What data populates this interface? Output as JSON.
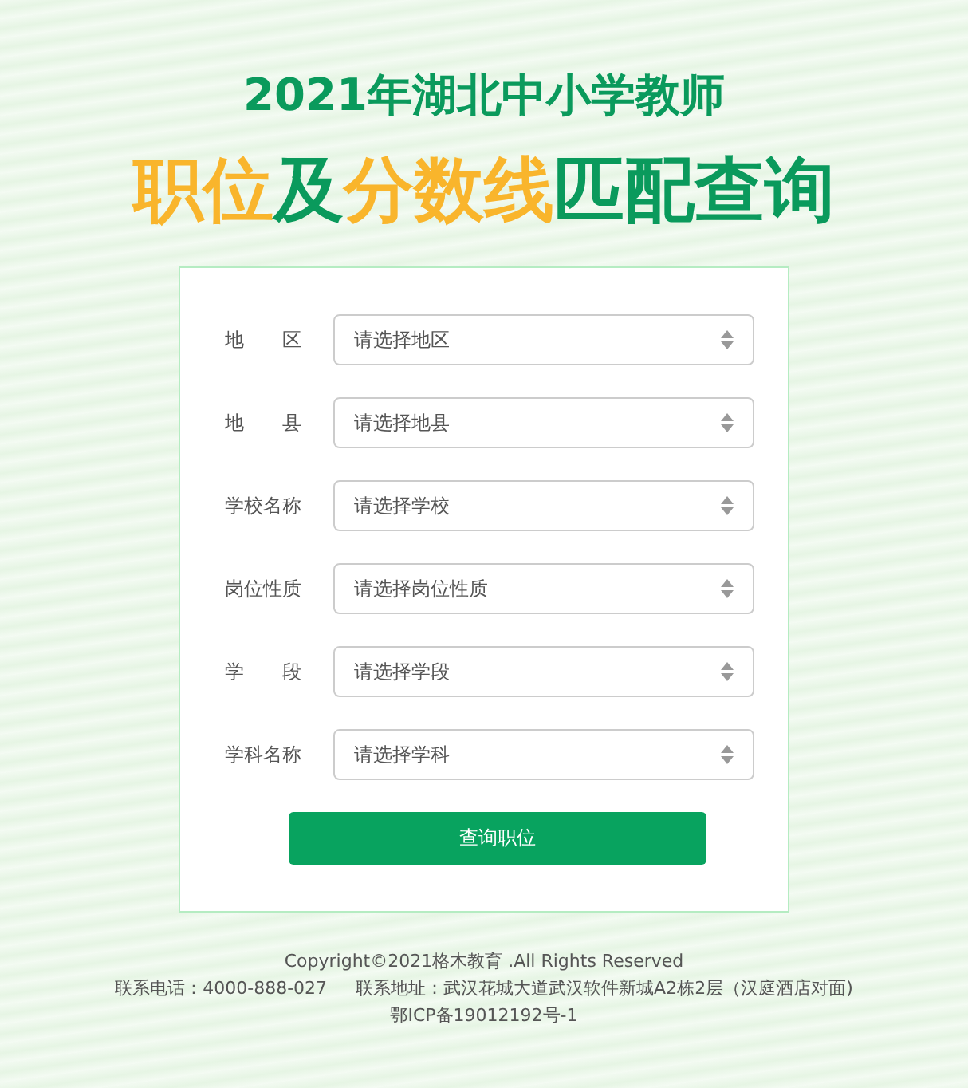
{
  "title": "2021年湖北中小学教师",
  "subtitle": [
    {
      "text": "职位",
      "kind": "accent"
    },
    {
      "text": "及",
      "kind": "primary"
    },
    {
      "text": "分数线",
      "kind": "accent"
    },
    {
      "text": "匹配查询",
      "kind": "primary"
    }
  ],
  "form": {
    "fields": [
      {
        "label": "地 区",
        "placeholder": "请选择地区"
      },
      {
        "label": "地 县",
        "placeholder": "请选择地县"
      },
      {
        "label": "学校名称",
        "placeholder": "请选择学校"
      },
      {
        "label": "岗位性质",
        "placeholder": "请选择岗位性质"
      },
      {
        "label": "学 段",
        "placeholder": "请选择学段"
      },
      {
        "label": "学科名称",
        "placeholder": "请选择学科"
      }
    ],
    "submit": "查询职位"
  },
  "footer": {
    "copyright": "Copyright©2021格木教育 .All Rights Reserved",
    "phone": "联系电话：4000-888-027",
    "address": "联系地址：武汉花城大道武汉软件新城A2栋2层（汉庭酒店对面)",
    "icp": "鄂ICP备19012192号-1"
  }
}
